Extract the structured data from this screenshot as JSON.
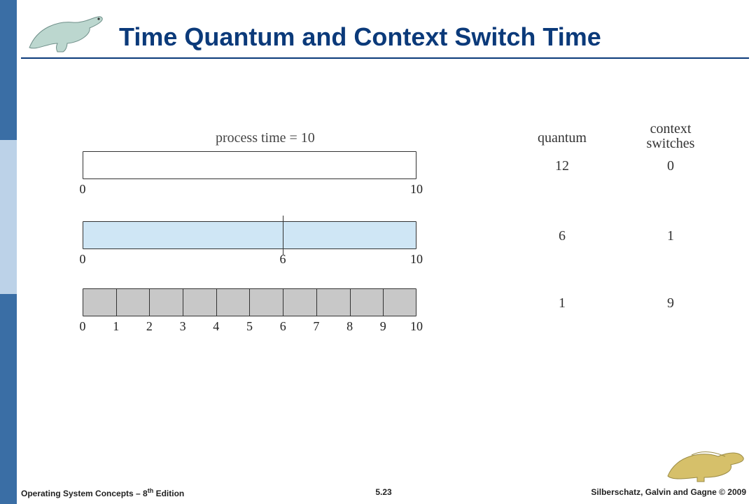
{
  "title": "Time Quantum and Context Switch Time",
  "process_time_label": "process time = 10",
  "columns": {
    "quantum": "quantum",
    "context_switches": "context\nswitches"
  },
  "rows": [
    {
      "quantum": "12",
      "context_switches": "0",
      "left_tick": "0",
      "right_tick": "10",
      "mid_tick": null
    },
    {
      "quantum": "6",
      "context_switches": "1",
      "left_tick": "0",
      "right_tick": "10",
      "mid_tick": "6"
    },
    {
      "quantum": "1",
      "context_switches": "9",
      "ticks": [
        "0",
        "1",
        "2",
        "3",
        "4",
        "5",
        "6",
        "7",
        "8",
        "9",
        "10"
      ]
    }
  ],
  "footer": {
    "left_a": "Operating System Concepts – 8",
    "left_sup": "th",
    "left_b": " Edition",
    "center": "5.23",
    "right": "Silberschatz, Galvin and Gagne © 2009"
  },
  "chart_data": {
    "type": "table",
    "title": "Time Quantum and Context Switch Time",
    "process_time": 10,
    "columns": [
      "quantum",
      "context_switches"
    ],
    "series": [
      {
        "quantum": 12,
        "context_switches": 0,
        "slice_boundaries": [
          0,
          10
        ]
      },
      {
        "quantum": 6,
        "context_switches": 1,
        "slice_boundaries": [
          0,
          6,
          10
        ]
      },
      {
        "quantum": 1,
        "context_switches": 9,
        "slice_boundaries": [
          0,
          1,
          2,
          3,
          4,
          5,
          6,
          7,
          8,
          9,
          10
        ]
      }
    ],
    "xlim": [
      0,
      10
    ]
  }
}
